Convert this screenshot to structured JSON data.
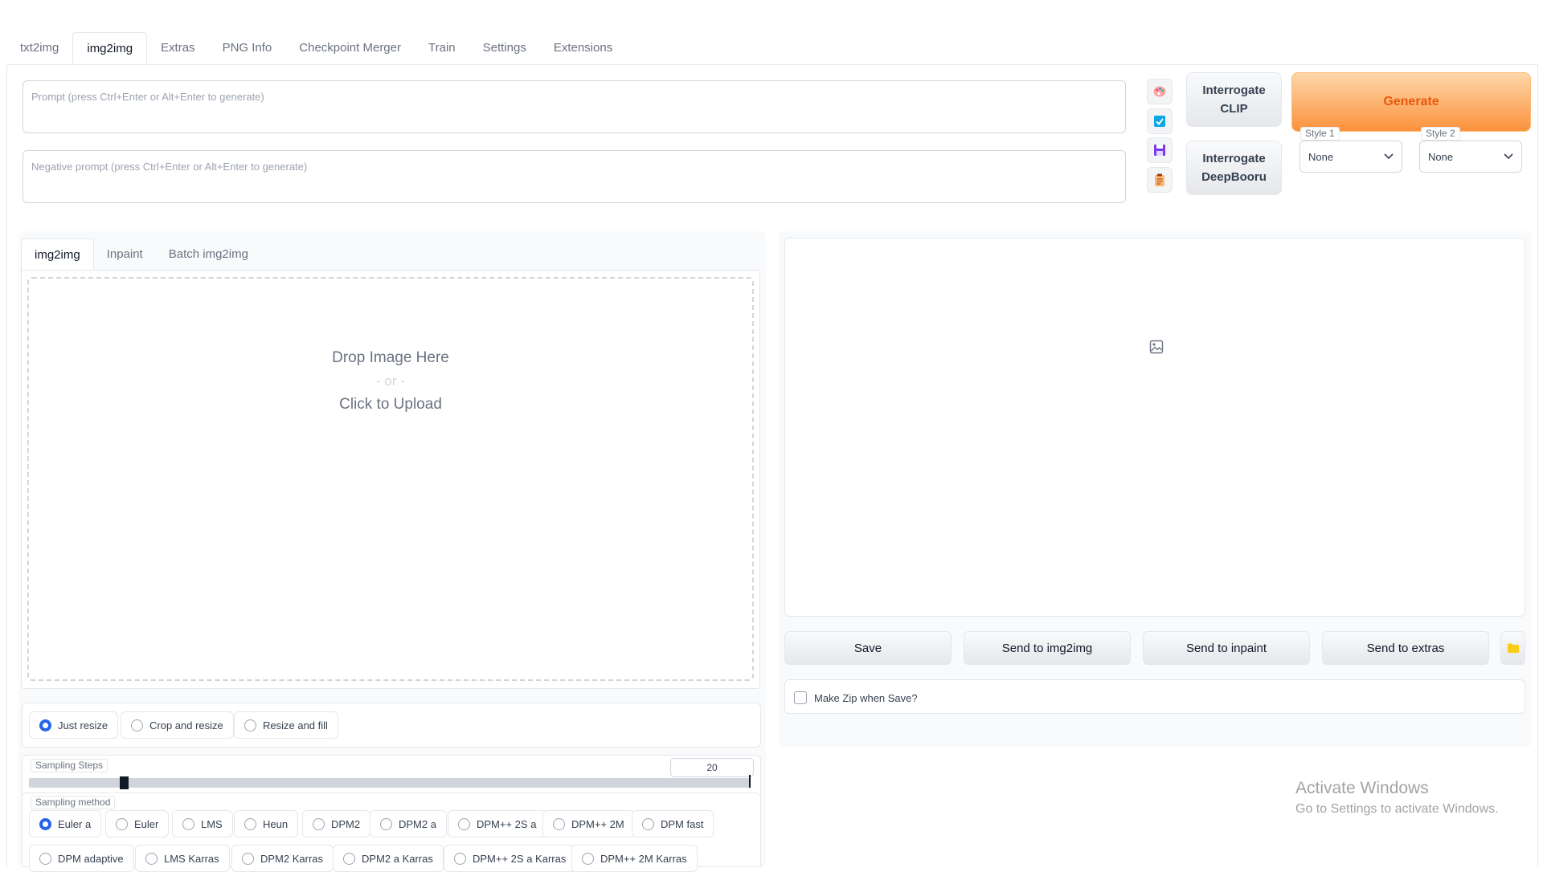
{
  "tabs": [
    "txt2img",
    "img2img",
    "Extras",
    "PNG Info",
    "Checkpoint Merger",
    "Train",
    "Settings",
    "Extensions"
  ],
  "prompt": {
    "placeholder": "Prompt (press Ctrl+Enter or Alt+Enter to generate)"
  },
  "negative_prompt": {
    "placeholder": "Negative prompt (press Ctrl+Enter or Alt+Enter to generate)"
  },
  "tools": [
    "palette-icon",
    "checkbox-icon",
    "save-icon",
    "clipboard-icon"
  ],
  "interrogate_clip": {
    "line1": "Interrogate",
    "line2": "CLIP"
  },
  "interrogate_deepbooru": {
    "line1": "Interrogate",
    "line2": "DeepBooru"
  },
  "generate_label": "Generate",
  "style1": {
    "label": "Style 1",
    "value": "None"
  },
  "style2": {
    "label": "Style 2",
    "value": "None"
  },
  "sub_tabs": [
    "img2img",
    "Inpaint",
    "Batch img2img"
  ],
  "drop": {
    "line1": "Drop Image Here",
    "line2": "- or -",
    "line3": "Click to Upload"
  },
  "resize_modes": [
    {
      "label": "Just resize",
      "selected": true
    },
    {
      "label": "Crop and resize",
      "selected": false
    },
    {
      "label": "Resize and fill",
      "selected": false
    }
  ],
  "sampling_steps": {
    "label": "Sampling Steps",
    "value": "20",
    "min": 1,
    "max": 150
  },
  "sampling_method": {
    "label": "Sampling method",
    "row1": [
      {
        "label": "Euler a",
        "selected": true
      },
      {
        "label": "Euler",
        "selected": false
      },
      {
        "label": "LMS",
        "selected": false
      },
      {
        "label": "Heun",
        "selected": false
      },
      {
        "label": "DPM2",
        "selected": false
      },
      {
        "label": "DPM2 a",
        "selected": false
      },
      {
        "label": "DPM++ 2S a",
        "selected": false
      },
      {
        "label": "DPM++ 2M",
        "selected": false
      },
      {
        "label": "DPM fast",
        "selected": false
      }
    ],
    "row2": [
      {
        "label": "DPM adaptive",
        "selected": false
      },
      {
        "label": "LMS Karras",
        "selected": false
      },
      {
        "label": "DPM2 Karras",
        "selected": false
      },
      {
        "label": "DPM2 a Karras",
        "selected": false
      },
      {
        "label": "DPM++ 2S a Karras",
        "selected": false
      },
      {
        "label": "DPM++ 2M Karras",
        "selected": false
      }
    ]
  },
  "output_buttons": {
    "save": "Save",
    "send_img2img": "Send to img2img",
    "send_inpaint": "Send to inpaint",
    "send_extras": "Send to extras"
  },
  "make_zip_label": "Make Zip when Save?",
  "watermark": {
    "line1": "Activate Windows",
    "line2": "Go to Settings to activate Windows."
  },
  "colors": {
    "accent": "#2563eb",
    "generate": "#fb923c",
    "generate_text": "#ea580c"
  }
}
